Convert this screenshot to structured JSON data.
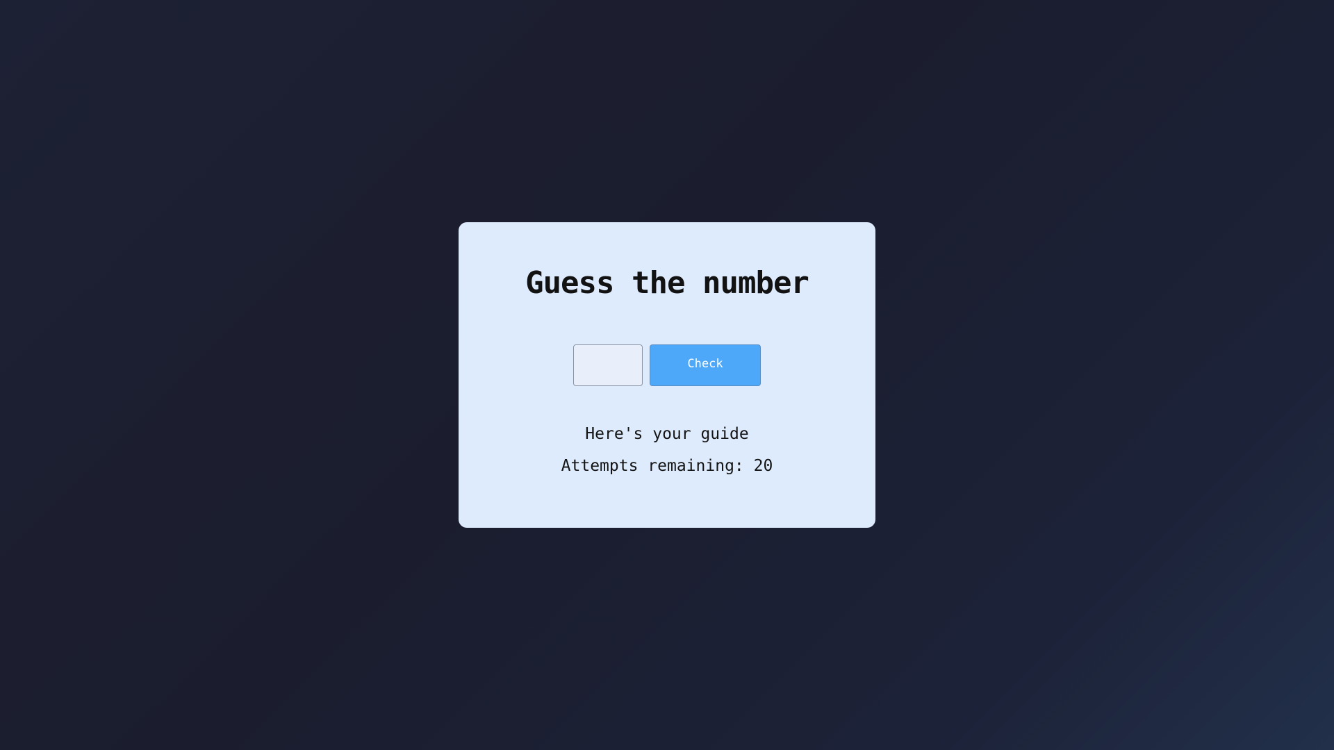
{
  "game": {
    "title": "Guess the number",
    "input_value": "",
    "input_placeholder": "",
    "check_label": "Check",
    "guide_text": "Here's your guide",
    "attempts_label": "Attempts remaining: ",
    "attempts_value": "20"
  },
  "colors": {
    "background": "#1c1f31",
    "card": "#deebfd",
    "button": "#4ea8fa",
    "text": "#141414"
  }
}
